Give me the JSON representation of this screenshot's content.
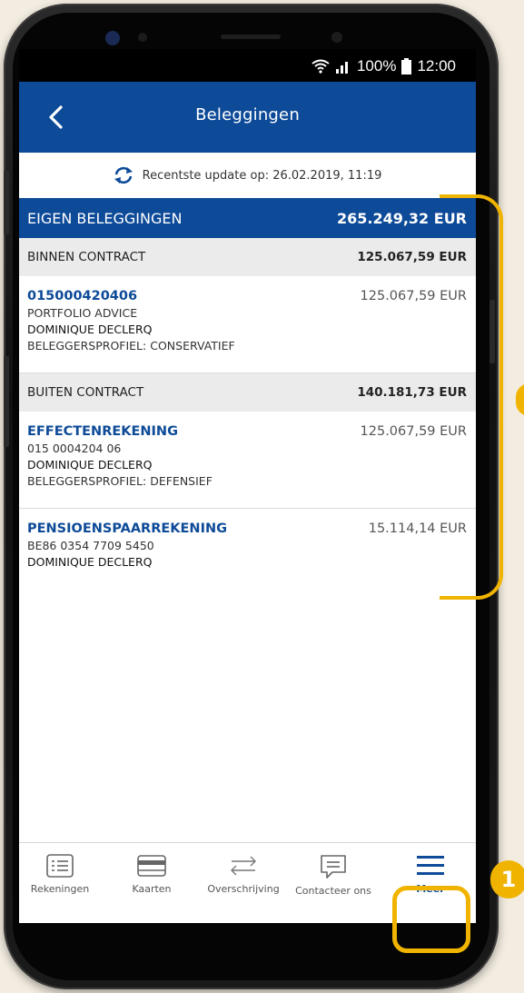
{
  "status": {
    "battery": "100%",
    "time": "12:00"
  },
  "header": {
    "title": "Beleggingen"
  },
  "update": {
    "text": "Recentste update op: 26.02.2019, 11:19"
  },
  "eigen": {
    "label": "EIGEN BELEGGINGEN",
    "amount": "265.249,32 EUR"
  },
  "binnen": {
    "label": "BINNEN CONTRACT",
    "amount": "125.067,59 EUR",
    "items": [
      {
        "title": "015000420406",
        "amount": "125.067,59 EUR",
        "line1": "PORTFOLIO ADVICE",
        "line2": "DOMINIQUE DECLERQ",
        "line3": "BELEGGERSPROFIEL: CONSERVATIEF"
      }
    ]
  },
  "buiten": {
    "label": "BUITEN CONTRACT",
    "amount": "140.181,73 EUR",
    "items": [
      {
        "title": "EFFECTENREKENING",
        "amount": "125.067,59 EUR",
        "line1": "015 0004204 06",
        "line2": "DOMINIQUE DECLERQ",
        "line3": "BELEGGERSPROFIEL: DEFENSIEF"
      },
      {
        "title": "PENSIOENSPAARREKENING",
        "amount": "15.114,14 EUR",
        "line1": "BE86 0354 7709 5450",
        "line2": "DOMINIQUE DECLERQ"
      }
    ]
  },
  "tabs": [
    {
      "label": "Rekeningen",
      "icon": "list-icon"
    },
    {
      "label": "Kaarten",
      "icon": "card-icon"
    },
    {
      "label": "Overschrijving",
      "icon": "transfer-icon"
    },
    {
      "label": "Contacteer ons",
      "icon": "chat-icon"
    },
    {
      "label": "Meer",
      "icon": "menu-icon"
    }
  ],
  "annotation": {
    "badge1": "1"
  },
  "colors": {
    "brand": "#0d4a98",
    "highlight": "#f0b400"
  }
}
